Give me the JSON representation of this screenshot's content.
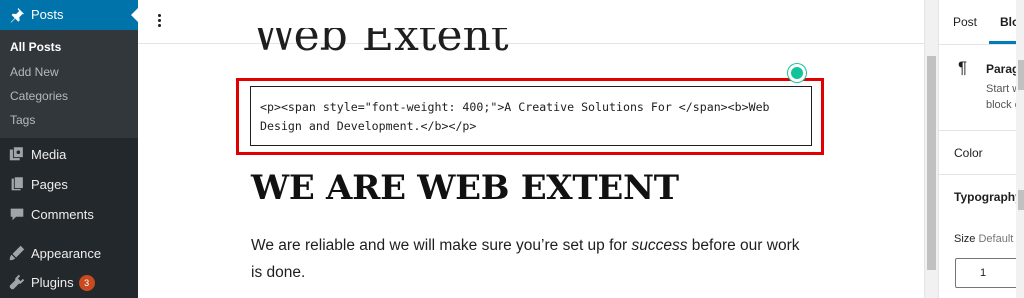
{
  "admin_menu": {
    "posts": {
      "label": "Posts",
      "icon": "pushpin-icon"
    },
    "submenu": [
      "All Posts",
      "Add New",
      "Categories",
      "Tags"
    ],
    "items": [
      {
        "label": "Media",
        "icon": "media-icon"
      },
      {
        "label": "Pages",
        "icon": "pages-icon"
      },
      {
        "label": "Comments",
        "icon": "comments-icon"
      },
      {
        "label": "Appearance",
        "icon": "appearance-icon"
      },
      {
        "label": "Plugins",
        "icon": "plugins-icon",
        "badge": "3"
      }
    ]
  },
  "editor": {
    "title_fragment": "Web Extent",
    "code_line1": "<p><span style=\"font-weight: 400;\">A Creative Solutions For </span><b>Web",
    "code_line2": "Design and Development.</b></p>",
    "heading": "WE ARE WEB EXTENT",
    "paragraph_before": "We are reliable and we will make sure you’re set up for ",
    "paragraph_em": "success",
    "paragraph_after": " before our work is done."
  },
  "settings": {
    "tab_post": "Post",
    "tab_block": "Block",
    "block_name": "Paragraph",
    "block_desc": "Start with the building block of all narrative.",
    "panel_color": "Color",
    "panel_typography": "Typography",
    "size_label": "Size",
    "size_default": "Default",
    "size_value": "1"
  },
  "colors": {
    "sidebar_bg": "#23282d",
    "active_blue": "#0073aa",
    "highlight_red": "#e00000",
    "badge": "#ca4a1f",
    "grammarly": "#15c39a"
  }
}
